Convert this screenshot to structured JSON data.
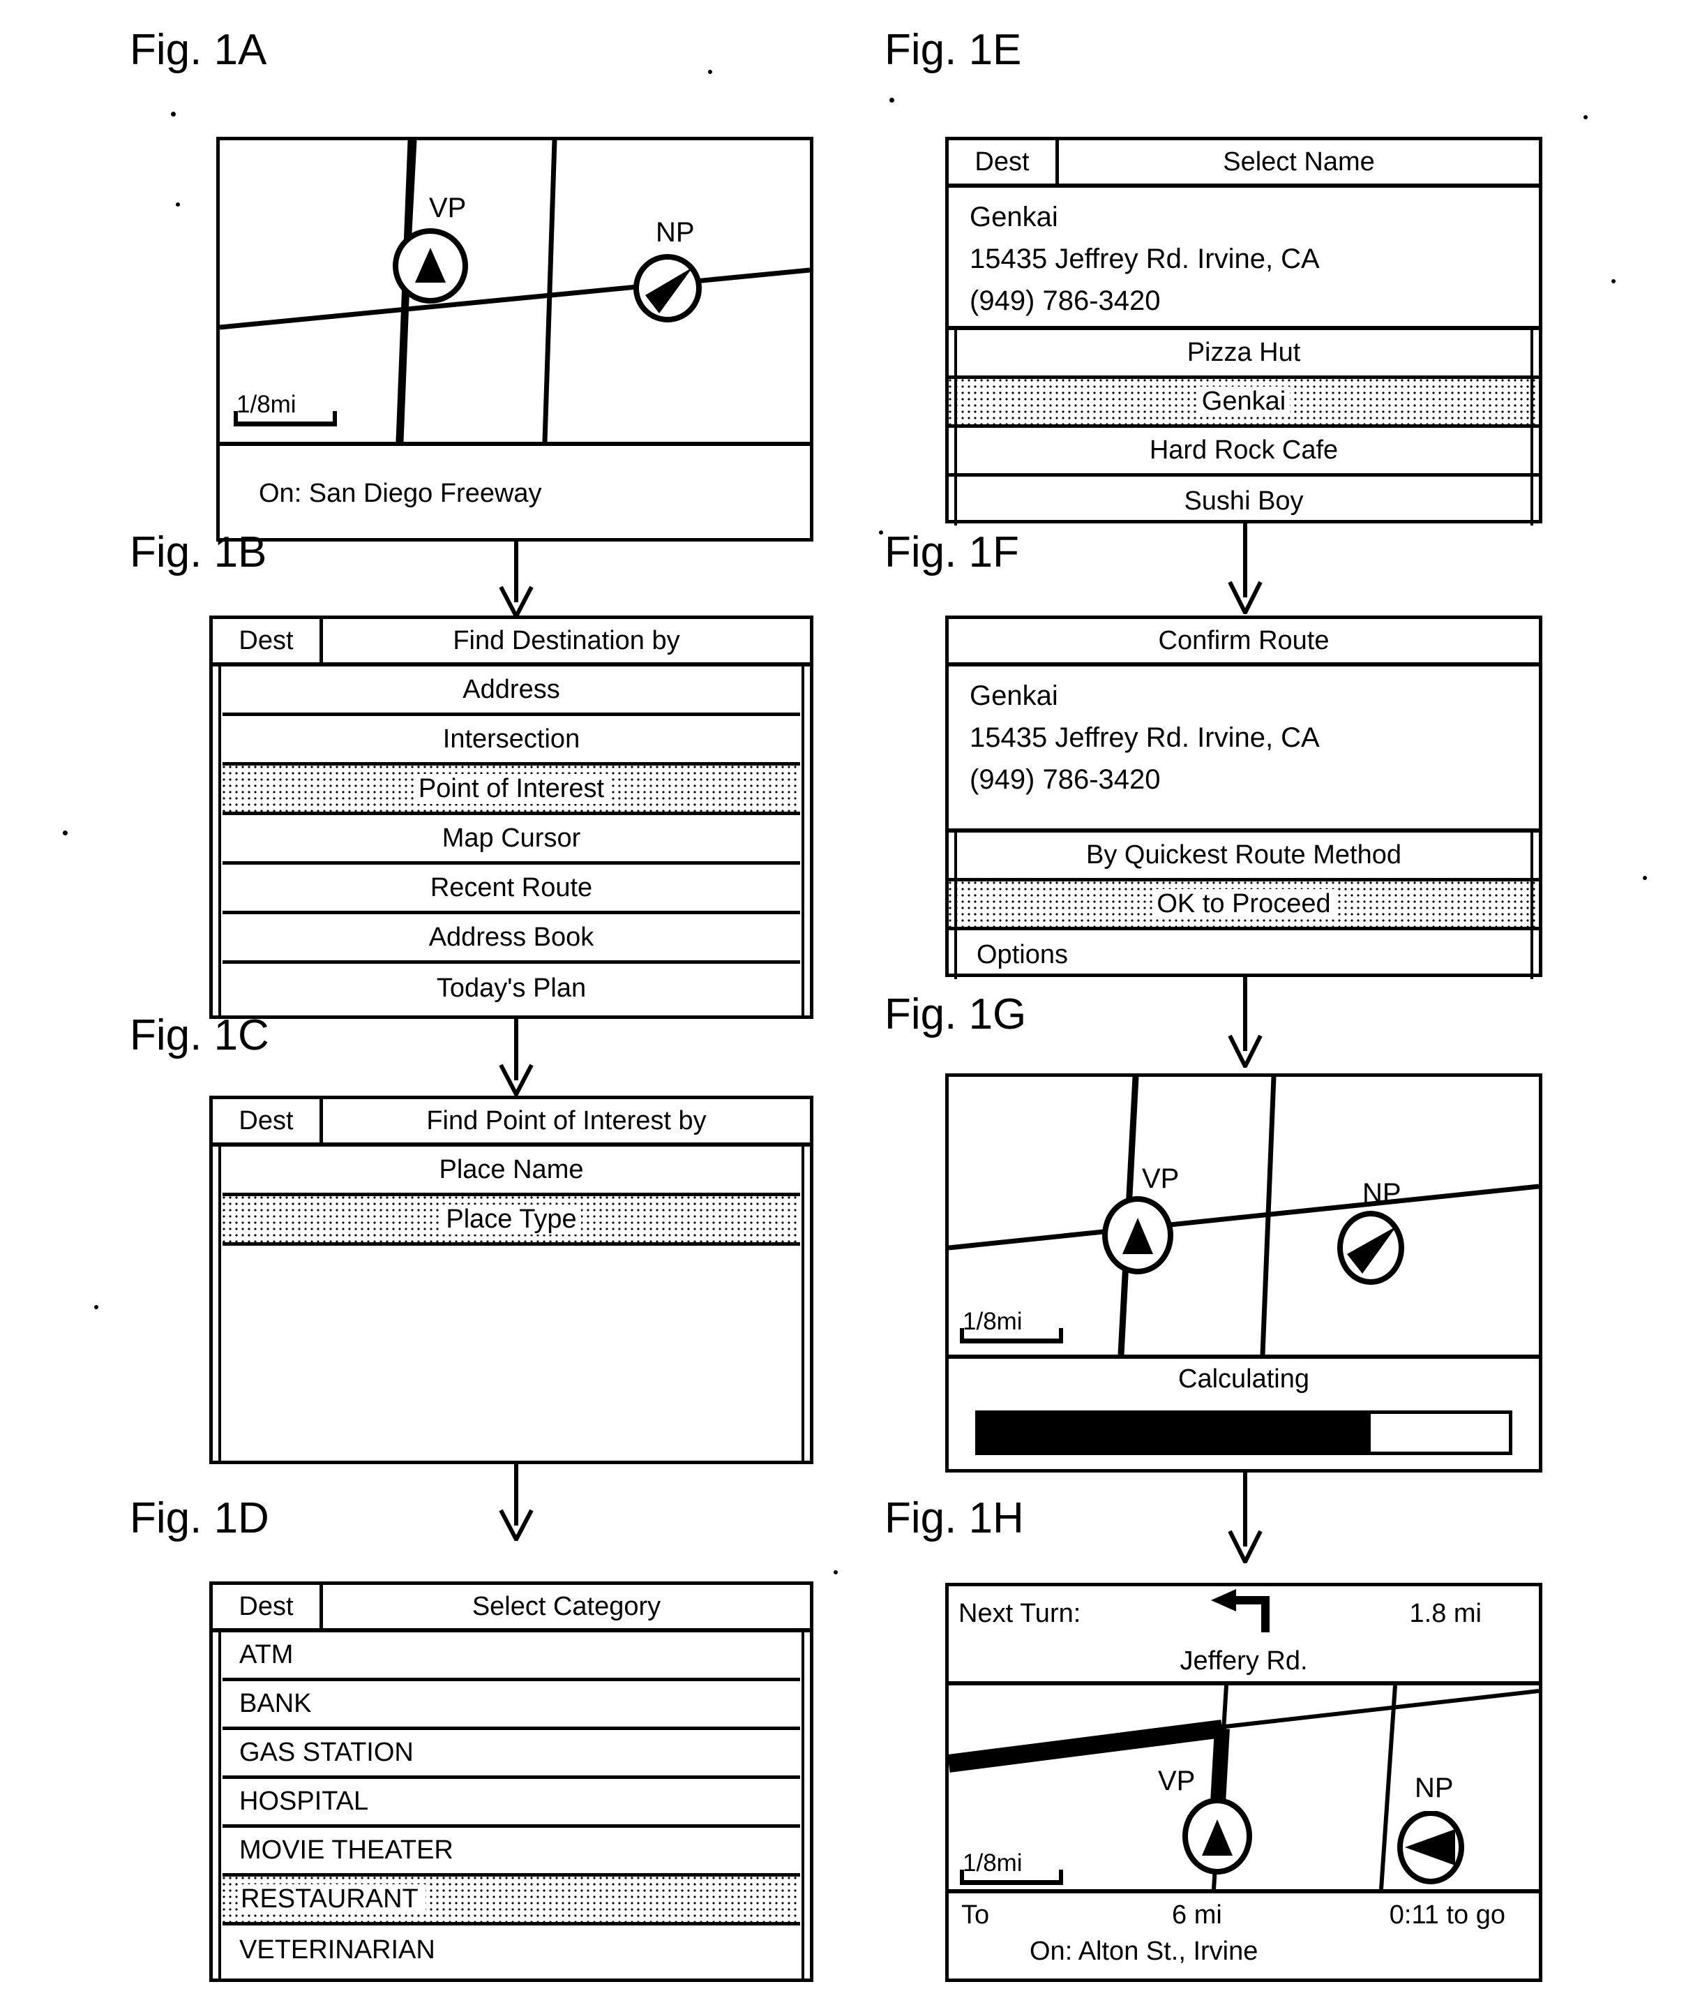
{
  "figures": {
    "a": {
      "label": "Fig. 1A",
      "scale": "1/8mi",
      "vp": "VP",
      "np": "NP",
      "status": "On:  San Diego Freeway"
    },
    "b": {
      "label": "Fig. 1B",
      "dest": "Dest",
      "title": "Find Destination by",
      "items": [
        {
          "text": "Address",
          "selected": false
        },
        {
          "text": "Intersection",
          "selected": false
        },
        {
          "text": "Point of Interest",
          "selected": true
        },
        {
          "text": "Map Cursor",
          "selected": false
        },
        {
          "text": "Recent Route",
          "selected": false
        },
        {
          "text": "Address Book",
          "selected": false
        },
        {
          "text": "Today's Plan",
          "selected": false
        }
      ]
    },
    "c": {
      "label": "Fig. 1C",
      "dest": "Dest",
      "title": "Find Point of Interest by",
      "items": [
        {
          "text": "Place Name",
          "selected": false
        },
        {
          "text": "Place Type",
          "selected": true
        }
      ]
    },
    "d": {
      "label": "Fig. 1D",
      "dest": "Dest",
      "title": "Select Category",
      "items": [
        {
          "text": "ATM",
          "selected": false
        },
        {
          "text": "BANK",
          "selected": false
        },
        {
          "text": "GAS STATION",
          "selected": false
        },
        {
          "text": "HOSPITAL",
          "selected": false
        },
        {
          "text": "MOVIE THEATER",
          "selected": false
        },
        {
          "text": "RESTAURANT",
          "selected": true
        },
        {
          "text": "VETERINARIAN",
          "selected": false
        }
      ]
    },
    "e": {
      "label": "Fig. 1E",
      "dest": "Dest",
      "title": "Select Name",
      "detail": {
        "name": "Genkai",
        "address": "15435 Jeffrey Rd. Irvine, CA",
        "phone": "(949) 786-3420"
      },
      "items": [
        {
          "text": "Pizza Hut",
          "selected": false
        },
        {
          "text": "Genkai",
          "selected": true
        },
        {
          "text": "Hard Rock Cafe",
          "selected": false
        },
        {
          "text": "Sushi Boy",
          "selected": false
        }
      ]
    },
    "f": {
      "label": "Fig. 1F",
      "title": "Confirm Route",
      "detail": {
        "name": "Genkai",
        "address": "15435 Jeffrey Rd. Irvine, CA",
        "phone": "(949) 786-3420"
      },
      "items": [
        {
          "text": "By Quickest Route Method",
          "selected": false
        },
        {
          "text": "OK to Proceed",
          "selected": true
        },
        {
          "text": "Options",
          "selected": false
        }
      ]
    },
    "g": {
      "label": "Fig. 1G",
      "scale": "1/8mi",
      "vp": "VP",
      "np": "NP",
      "status": "Calculating",
      "progress_percent": 74
    },
    "h": {
      "label": "Fig. 1H",
      "next_turn_label": "Next Turn:",
      "next_turn_distance": "1.8 mi",
      "turn_icon": "turn-left-arrow-icon",
      "street": "Jeffery Rd.",
      "scale": "1/8mi",
      "vp": "VP",
      "np": "NP",
      "to_label": "To",
      "to_distance": "6 mi",
      "eta": "0:11 to go",
      "on_street": "On:  Alton St., Irvine"
    }
  },
  "colors": {
    "ink": "#000000",
    "paper": "#ffffff"
  }
}
